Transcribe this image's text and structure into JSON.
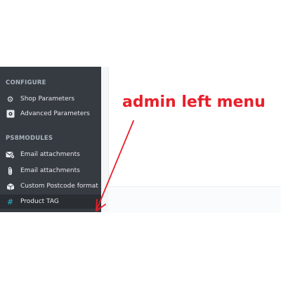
{
  "sidebar": {
    "sections": [
      {
        "title": "CONFIGURE",
        "items": [
          {
            "label": "Shop Parameters",
            "icon": "gear-icon"
          },
          {
            "label": "Advanced Parameters",
            "icon": "puzzle-gear-icon"
          }
        ]
      },
      {
        "title": "PS8MODULES",
        "items": [
          {
            "label": "Email attachments",
            "icon": "envelope-gear-icon"
          },
          {
            "label": "Email attachments",
            "icon": "paperclip-icon"
          },
          {
            "label": "Custom Postcode format",
            "icon": "box-icon"
          },
          {
            "label": "Product TAG",
            "icon": "hashtag-icon",
            "active": true
          }
        ]
      }
    ]
  },
  "annotation": {
    "text": "admin left menu",
    "color": "#e8202a"
  },
  "colors": {
    "sidebar_bg": "#363a41",
    "active_bg": "#2a2d32",
    "accent": "#25b9d7"
  }
}
